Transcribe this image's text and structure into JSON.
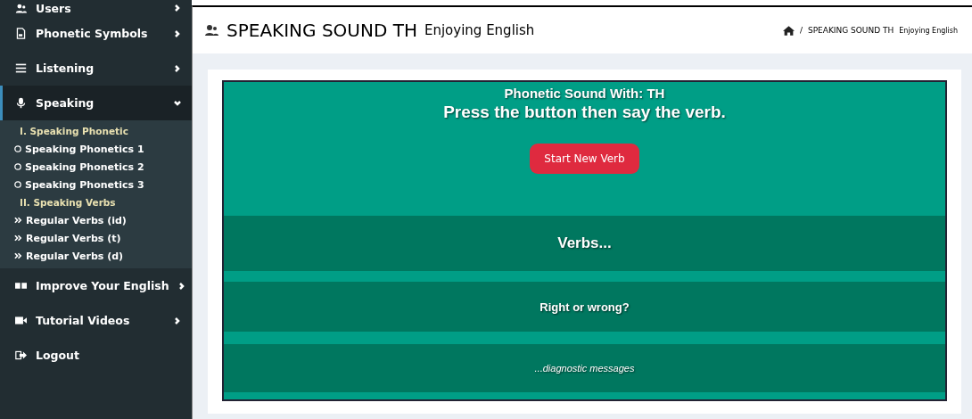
{
  "sidebar": {
    "items": [
      {
        "label": "Users",
        "selected": false
      },
      {
        "label": "Phonetic Symbols",
        "selected": false
      },
      {
        "label": "Listening",
        "selected": false
      },
      {
        "label": "Speaking",
        "selected": true,
        "expanded": true,
        "children": [
          {
            "kind": "header",
            "label": "I. Speaking Phonetic"
          },
          {
            "kind": "circle",
            "label": "Speaking Phonetics 1"
          },
          {
            "kind": "circle",
            "label": "Speaking Phonetics 2"
          },
          {
            "kind": "circle",
            "label": "Speaking Phonetics 3"
          },
          {
            "kind": "header",
            "label": "II. Speaking Verbs"
          },
          {
            "kind": "double",
            "label": "Regular Verbs (id)"
          },
          {
            "kind": "double",
            "label": "Regular Verbs (t)"
          },
          {
            "kind": "double",
            "label": "Regular Verbs (d)"
          }
        ]
      },
      {
        "label": "Improve Your English",
        "selected": false
      },
      {
        "label": "Tutorial Videos",
        "selected": false
      },
      {
        "label": "Logout",
        "selected": false
      }
    ]
  },
  "header": {
    "title": "SPEAKING SOUND TH",
    "subtitle": "Enjoying English",
    "breadcrumb": {
      "separator": "/",
      "title": "SPEAKING SOUND TH",
      "subtitle": "Enjoying English"
    }
  },
  "panel": {
    "heading": "Phonetic Sound With: TH",
    "instruction": "Press the button then say the verb.",
    "button": "Start New Verb",
    "verbs": "Verbs...",
    "result": "Right or wrong?",
    "diagnostics": "...diagnostic messages"
  }
}
